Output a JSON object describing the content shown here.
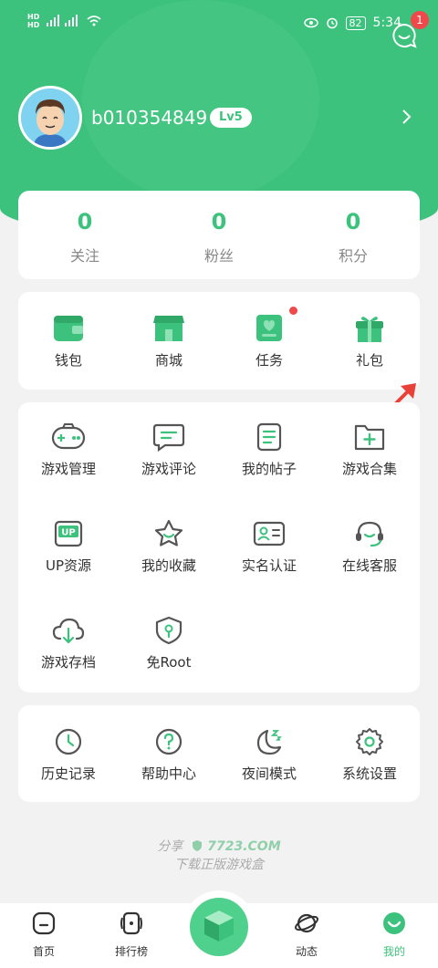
{
  "status_bar": {
    "time": "5:34",
    "battery": "82",
    "left_icons": [
      "hd-icon",
      "signal-icon",
      "wifi-icon"
    ],
    "right_icons": [
      "eye-icon",
      "alarm-icon"
    ]
  },
  "header": {
    "message_badge": "1"
  },
  "profile": {
    "username": "b010354849",
    "level": "Lv5"
  },
  "stats": [
    {
      "value": "0",
      "label": "关注"
    },
    {
      "value": "0",
      "label": "粉丝"
    },
    {
      "value": "0",
      "label": "积分"
    }
  ],
  "quick_actions": [
    {
      "label": "钱包",
      "icon": "wallet-icon"
    },
    {
      "label": "商城",
      "icon": "shop-icon"
    },
    {
      "label": "任务",
      "icon": "task-icon"
    },
    {
      "label": "礼包",
      "icon": "gift-icon"
    }
  ],
  "menu": [
    {
      "label": "游戏管理",
      "icon": "gamepad-icon"
    },
    {
      "label": "游戏评论",
      "icon": "comment-icon"
    },
    {
      "label": "我的帖子",
      "icon": "post-icon"
    },
    {
      "label": "游戏合集",
      "icon": "folder-add-icon"
    },
    {
      "label": "UP资源",
      "icon": "up-resource-icon"
    },
    {
      "label": "我的收藏",
      "icon": "star-icon"
    },
    {
      "label": "实名认证",
      "icon": "id-card-icon"
    },
    {
      "label": "在线客服",
      "icon": "headset-icon"
    },
    {
      "label": "游戏存档",
      "icon": "cloud-download-icon"
    },
    {
      "label": "免Root",
      "icon": "shield-icon"
    }
  ],
  "settings": [
    {
      "label": "历史记录",
      "icon": "clock-icon"
    },
    {
      "label": "帮助中心",
      "icon": "help-icon"
    },
    {
      "label": "夜间模式",
      "icon": "moon-icon"
    },
    {
      "label": "系统设置",
      "icon": "gear-icon"
    }
  ],
  "share": {
    "prefix": "分享",
    "brand": "7723.COM",
    "subtitle": "下载正版游戏盒"
  },
  "bottom_nav": [
    {
      "label": "首页",
      "icon": "home-icon"
    },
    {
      "label": "排行榜",
      "icon": "ranking-icon"
    },
    {
      "label": "动态",
      "icon": "planet-icon"
    },
    {
      "label": "我的",
      "icon": "smiley-icon"
    }
  ],
  "colors": {
    "primary": "#3cc27c",
    "badge": "#f0484b",
    "background": "#f2f2f2"
  }
}
